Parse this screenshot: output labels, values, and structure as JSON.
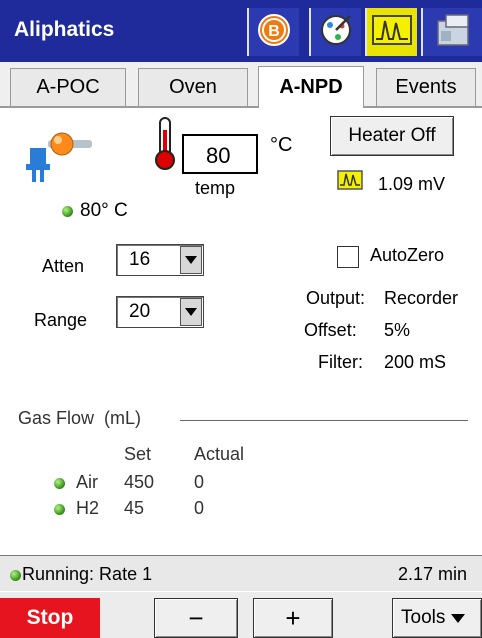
{
  "app": {
    "title": "Aliphatics"
  },
  "toolbar": {
    "icons": [
      "b-badge-icon",
      "dial-icon",
      "signal-icon",
      "instrument-icon"
    ],
    "badge_letter": "B"
  },
  "tabs": [
    {
      "label": "A-POC",
      "active": false
    },
    {
      "label": "Oven",
      "active": false
    },
    {
      "label": "A-NPD",
      "active": true
    },
    {
      "label": "Events",
      "active": false
    }
  ],
  "detector": {
    "temp_setpoint": "80",
    "temp_unit": "°C",
    "temp_caption": "temp",
    "actual_temp": "80° C",
    "heater_button": "Heater Off",
    "signal_value": "1.09 mV"
  },
  "controls": {
    "atten_label": "Atten",
    "atten_value": "16",
    "range_label": "Range",
    "range_value": "20",
    "autozero_label": "AutoZero",
    "autozero_checked": false
  },
  "output": {
    "output_label": "Output:",
    "output_value": "Recorder",
    "offset_label": "Offset:",
    "offset_value": "5%",
    "filter_label": "Filter:",
    "filter_value": "200 mS"
  },
  "gasflow": {
    "title": "Gas Flow  (mL)",
    "col_set": "Set",
    "col_actual": "Actual",
    "rows": [
      {
        "name": "Air",
        "set": "450",
        "actual": "0"
      },
      {
        "name": "H2",
        "set": "45",
        "actual": "0"
      }
    ]
  },
  "status": {
    "text": "Running: Rate 1",
    "time": "2.17 min"
  },
  "bottom": {
    "stop_label": "Stop",
    "minus_label": "−",
    "plus_label": "+",
    "tools_label": "Tools"
  },
  "colors": {
    "titlebar": "#1f2b9a",
    "stop": "#e6141e",
    "status_dot": "#2d8c12"
  }
}
